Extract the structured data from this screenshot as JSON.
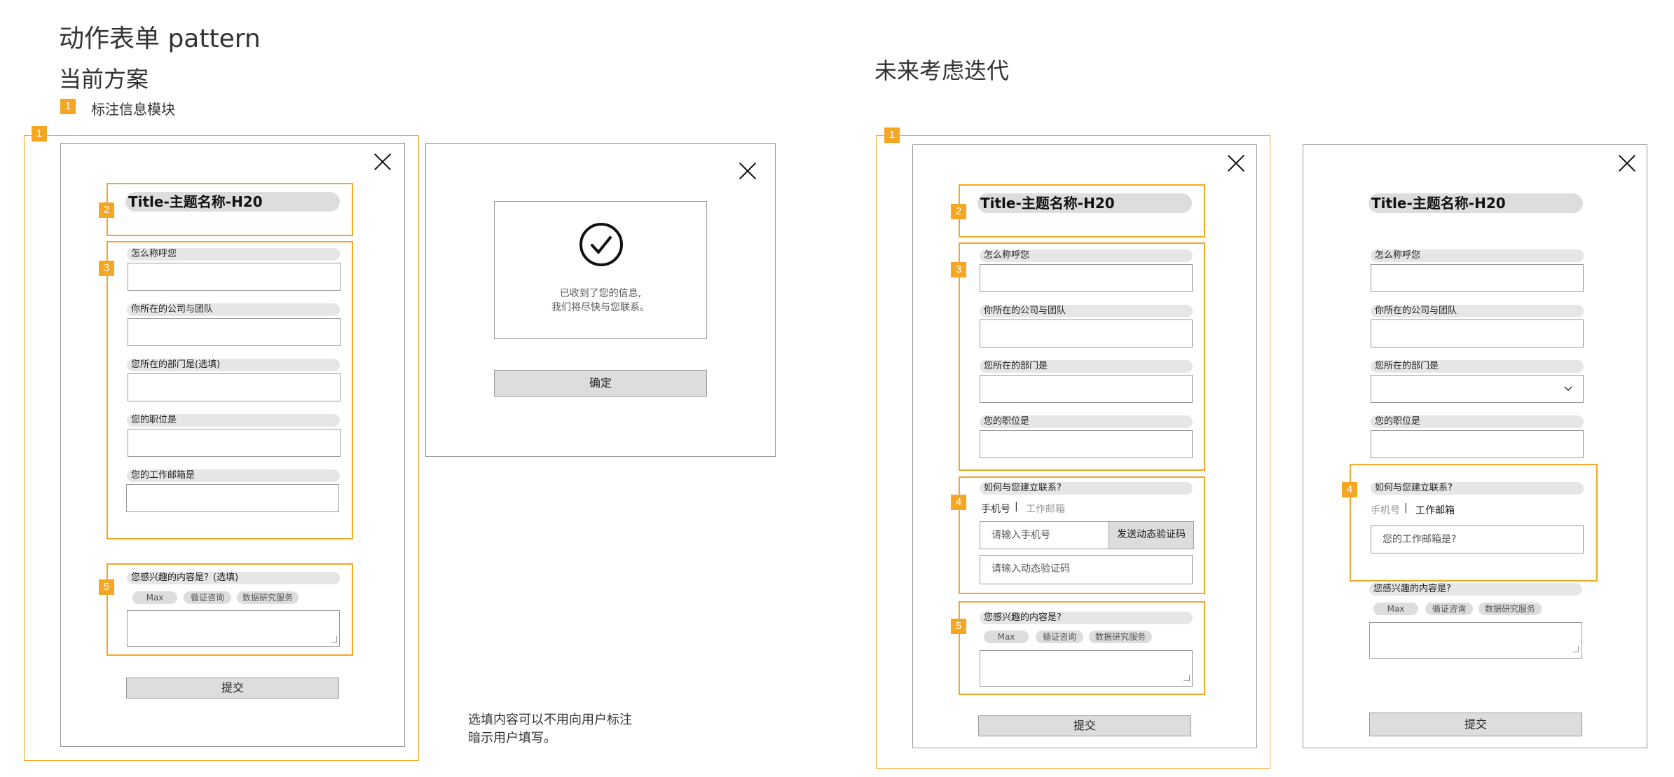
{
  "headings": {
    "main_title": "动作表单 pattern",
    "current_plan": "当前方案",
    "future_plan": "未来考虑迭代",
    "legend_badge": "1",
    "legend_label": "标注信息模块"
  },
  "badges": {
    "b1": "1",
    "b2": "2",
    "b3": "3",
    "b4": "4",
    "b5": "5"
  },
  "form": {
    "title": "Title-主题名称-H20",
    "q_name": "怎么称呼您",
    "q_company": "你所在的公司与团队",
    "q_dept_optional": "您所在的部门是(选填)",
    "q_dept": "您所在的部门是",
    "q_position": "您的职位是",
    "q_email": "您的工作邮箱是",
    "q_interest_optional": "您感兴趣的内容是？(选填)",
    "q_interest": "您感兴趣的内容是?",
    "tags": [
      "Max",
      "循证咨询",
      "数据研究服务"
    ],
    "submit": "提交"
  },
  "success": {
    "line1": "已收到了您的信息,",
    "line2": "我们将尽快与您联系。",
    "confirm": "确定"
  },
  "contact": {
    "q_contact": "如何与您建立联系?",
    "tab_phone": "手机号",
    "tab_email": "工作邮箱",
    "separator": "|",
    "phone_placeholder": "请输入手机号",
    "send_code": "发送动态验证码",
    "code_placeholder": "请输入动态验证码",
    "email_placeholder": "您的工作邮箱是?"
  },
  "note": {
    "line1": "选填内容可以不用向用户标注",
    "line2": "暗示用户填写。"
  },
  "colors": {
    "accent": "#F5A623",
    "gray_fill": "#dddddd",
    "border": "#999999"
  }
}
